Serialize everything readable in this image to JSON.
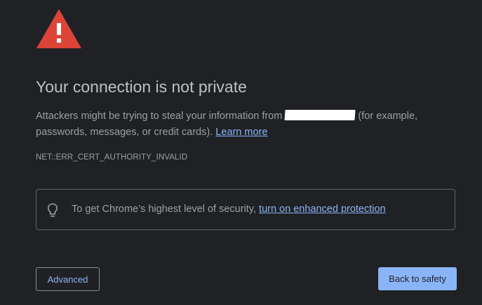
{
  "header": {
    "icon": "warning-triangle-icon",
    "icon_color": "#db4437",
    "title": "Your connection is not private"
  },
  "description": {
    "text_before": "Attackers might be trying to steal your information from ",
    "text_after": " (for example, passwords, messages, or credit cards). ",
    "learn_more_label": "Learn more"
  },
  "error_code": "NET::ERR_CERT_AUTHORITY_INVALID",
  "enhanced_protection": {
    "icon": "lightbulb-icon",
    "text": "To get Chrome’s highest level of security, ",
    "link_label": "turn on enhanced protection"
  },
  "buttons": {
    "advanced_label": "Advanced",
    "back_label": "Back to safety"
  },
  "colors": {
    "background": "#202124",
    "link": "#8ab4f8",
    "primary_button": "#8ab4f8"
  }
}
